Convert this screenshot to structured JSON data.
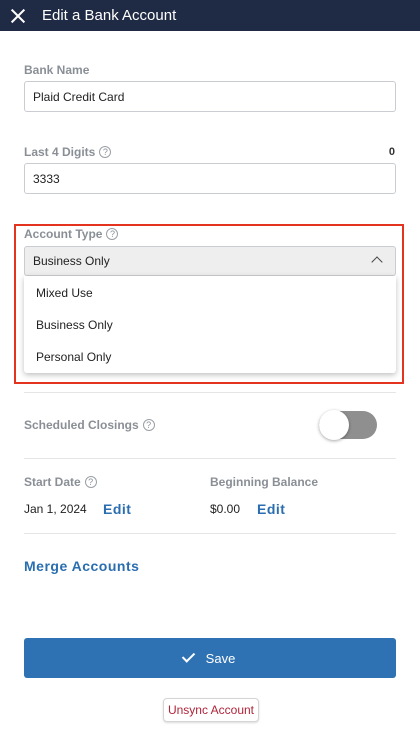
{
  "header": {
    "title": "Edit a Bank Account",
    "close_icon": "close-icon"
  },
  "bank_name": {
    "label": "Bank Name",
    "value": "Plaid Credit Card"
  },
  "last4": {
    "label": "Last 4 Digits",
    "help": "?",
    "counter": "0",
    "value": "3333"
  },
  "account_type": {
    "label": "Account Type",
    "help": "?",
    "selected": "Business Only",
    "options": [
      "Mixed Use",
      "Business Only",
      "Personal Only"
    ]
  },
  "scheduled_closings": {
    "label": "Scheduled Closings",
    "help": "?",
    "enabled": false
  },
  "start_date": {
    "label": "Start Date",
    "help": "?",
    "value": "Jan 1, 2024",
    "edit_label": "Edit"
  },
  "beginning_balance": {
    "label": "Beginning Balance",
    "value": "$0.00",
    "edit_label": "Edit"
  },
  "merge_accounts_label": "Merge Accounts",
  "save_label": "Save",
  "unsync_label": "Unsync Account",
  "colors": {
    "header_bg": "#1f2a44",
    "primary": "#2f72b3",
    "link": "#2a6eb0",
    "highlight": "#e4341f",
    "danger_text": "#b0243a"
  }
}
